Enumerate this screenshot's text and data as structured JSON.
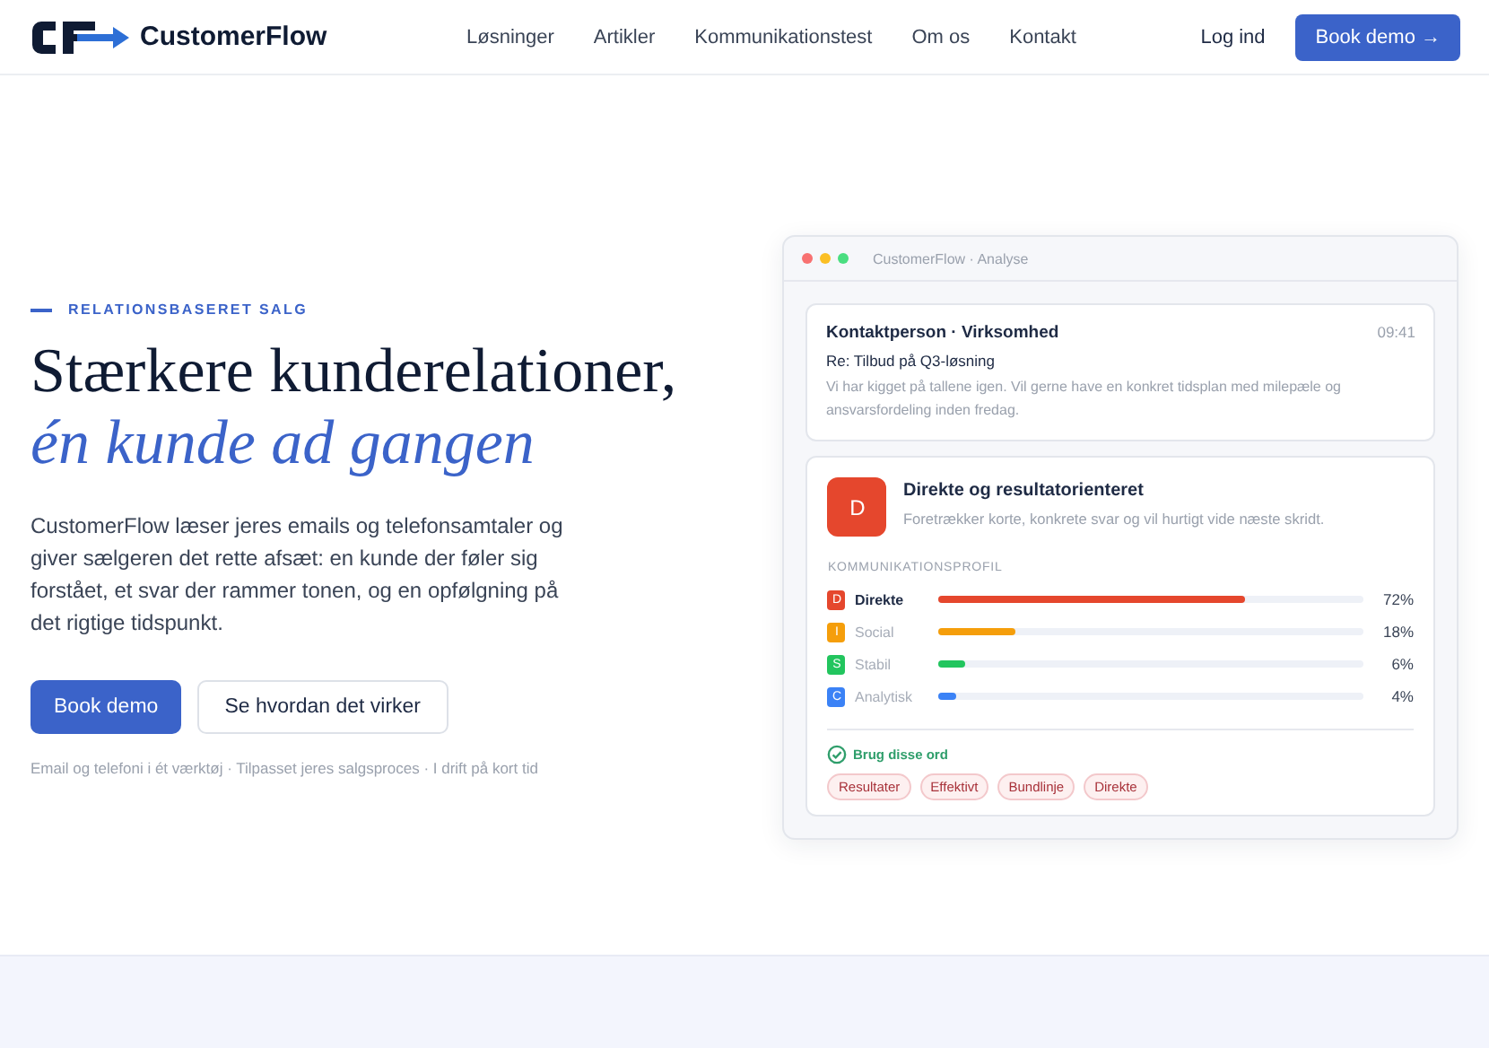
{
  "brand": {
    "name": "CustomerFlow"
  },
  "nav": [
    "Løsninger",
    "Artikler",
    "Kommunikationstest",
    "Om os",
    "Kontakt"
  ],
  "login": "Log ind",
  "header_cta": "Book demo →",
  "hero": {
    "eyebrow": "RELATIONSBASERET SALG",
    "title": "Stærkere kunderelationer,",
    "title_accent": "én kunde ad gangen",
    "body": "CustomerFlow læser jeres emails og telefonsamtaler og giver sælgeren det rette afsæt: en kunde der føler sig forstået, et svar der rammer tonen, og en opfølgning på det rigtige tidspunkt.",
    "primary_button": "Book demo",
    "secondary_button": "Se hvordan det virker",
    "footnote": "Email og telefoni i ét værktøj · Tilpasset jeres salgsproces · I drift på kort tid"
  },
  "app_window": {
    "title": "CustomerFlow · Analyse",
    "email": {
      "sender": "Kontaktperson · Virksomhed",
      "time": "09:41",
      "subject": "Re: Tilbud på Q3-løsning",
      "preview": "Vi har kigget på tallene igen. Vil gerne have en konkret tidsplan med milepæle og ansvarsfordeling inden fredag."
    },
    "profile": {
      "badge": "D",
      "title": "Direkte og resultatorienteret",
      "description": "Foretrækker korte, konkrete svar og vil hurtigt vide næste skridt.",
      "section_label": "KOMMUNIKATIONSPROFIL",
      "rows": [
        {
          "letter": "D",
          "name": "Direkte",
          "level": 0.72,
          "reading": "72%",
          "color": "#e5472d",
          "selected": true
        },
        {
          "letter": "I",
          "name": "Social",
          "level": 0.18,
          "reading": "18%",
          "color": "#f59e0b",
          "selected": false
        },
        {
          "letter": "S",
          "name": "Stabil",
          "level": 0.06,
          "reading": "6%",
          "color": "#22c55e",
          "selected": false
        },
        {
          "letter": "C",
          "name": "Analytisk",
          "level": 0.04,
          "reading": "4%",
          "color": "#3b82f6",
          "selected": false
        }
      ],
      "words_label": "Brug disse ord",
      "words": [
        "Resultater",
        "Effektivt",
        "Bundlinje",
        "Direkte"
      ]
    }
  }
}
